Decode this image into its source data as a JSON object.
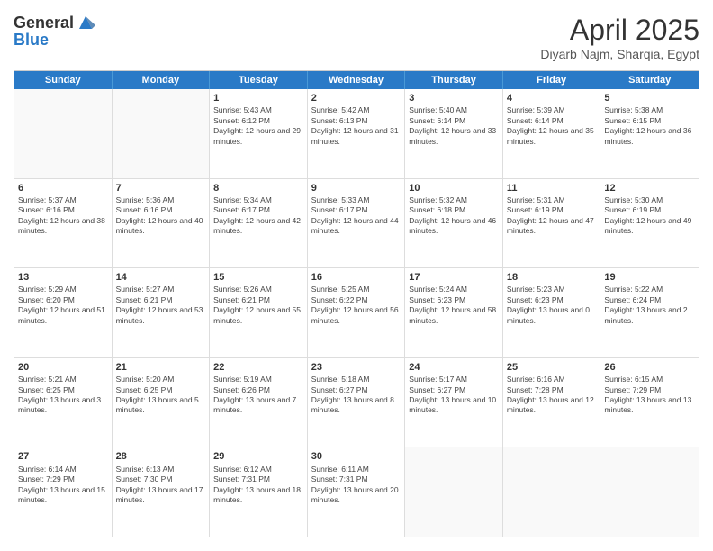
{
  "header": {
    "logo_line1": "General",
    "logo_line2": "Blue",
    "month": "April 2025",
    "location": "Diyarb Najm, Sharqia, Egypt"
  },
  "days": [
    "Sunday",
    "Monday",
    "Tuesday",
    "Wednesday",
    "Thursday",
    "Friday",
    "Saturday"
  ],
  "weeks": [
    [
      {
        "day": "",
        "info": ""
      },
      {
        "day": "",
        "info": ""
      },
      {
        "day": "1",
        "info": "Sunrise: 5:43 AM\nSunset: 6:12 PM\nDaylight: 12 hours and 29 minutes."
      },
      {
        "day": "2",
        "info": "Sunrise: 5:42 AM\nSunset: 6:13 PM\nDaylight: 12 hours and 31 minutes."
      },
      {
        "day": "3",
        "info": "Sunrise: 5:40 AM\nSunset: 6:14 PM\nDaylight: 12 hours and 33 minutes."
      },
      {
        "day": "4",
        "info": "Sunrise: 5:39 AM\nSunset: 6:14 PM\nDaylight: 12 hours and 35 minutes."
      },
      {
        "day": "5",
        "info": "Sunrise: 5:38 AM\nSunset: 6:15 PM\nDaylight: 12 hours and 36 minutes."
      }
    ],
    [
      {
        "day": "6",
        "info": "Sunrise: 5:37 AM\nSunset: 6:16 PM\nDaylight: 12 hours and 38 minutes."
      },
      {
        "day": "7",
        "info": "Sunrise: 5:36 AM\nSunset: 6:16 PM\nDaylight: 12 hours and 40 minutes."
      },
      {
        "day": "8",
        "info": "Sunrise: 5:34 AM\nSunset: 6:17 PM\nDaylight: 12 hours and 42 minutes."
      },
      {
        "day": "9",
        "info": "Sunrise: 5:33 AM\nSunset: 6:17 PM\nDaylight: 12 hours and 44 minutes."
      },
      {
        "day": "10",
        "info": "Sunrise: 5:32 AM\nSunset: 6:18 PM\nDaylight: 12 hours and 46 minutes."
      },
      {
        "day": "11",
        "info": "Sunrise: 5:31 AM\nSunset: 6:19 PM\nDaylight: 12 hours and 47 minutes."
      },
      {
        "day": "12",
        "info": "Sunrise: 5:30 AM\nSunset: 6:19 PM\nDaylight: 12 hours and 49 minutes."
      }
    ],
    [
      {
        "day": "13",
        "info": "Sunrise: 5:29 AM\nSunset: 6:20 PM\nDaylight: 12 hours and 51 minutes."
      },
      {
        "day": "14",
        "info": "Sunrise: 5:27 AM\nSunset: 6:21 PM\nDaylight: 12 hours and 53 minutes."
      },
      {
        "day": "15",
        "info": "Sunrise: 5:26 AM\nSunset: 6:21 PM\nDaylight: 12 hours and 55 minutes."
      },
      {
        "day": "16",
        "info": "Sunrise: 5:25 AM\nSunset: 6:22 PM\nDaylight: 12 hours and 56 minutes."
      },
      {
        "day": "17",
        "info": "Sunrise: 5:24 AM\nSunset: 6:23 PM\nDaylight: 12 hours and 58 minutes."
      },
      {
        "day": "18",
        "info": "Sunrise: 5:23 AM\nSunset: 6:23 PM\nDaylight: 13 hours and 0 minutes."
      },
      {
        "day": "19",
        "info": "Sunrise: 5:22 AM\nSunset: 6:24 PM\nDaylight: 13 hours and 2 minutes."
      }
    ],
    [
      {
        "day": "20",
        "info": "Sunrise: 5:21 AM\nSunset: 6:25 PM\nDaylight: 13 hours and 3 minutes."
      },
      {
        "day": "21",
        "info": "Sunrise: 5:20 AM\nSunset: 6:25 PM\nDaylight: 13 hours and 5 minutes."
      },
      {
        "day": "22",
        "info": "Sunrise: 5:19 AM\nSunset: 6:26 PM\nDaylight: 13 hours and 7 minutes."
      },
      {
        "day": "23",
        "info": "Sunrise: 5:18 AM\nSunset: 6:27 PM\nDaylight: 13 hours and 8 minutes."
      },
      {
        "day": "24",
        "info": "Sunrise: 5:17 AM\nSunset: 6:27 PM\nDaylight: 13 hours and 10 minutes."
      },
      {
        "day": "25",
        "info": "Sunrise: 6:16 AM\nSunset: 7:28 PM\nDaylight: 13 hours and 12 minutes."
      },
      {
        "day": "26",
        "info": "Sunrise: 6:15 AM\nSunset: 7:29 PM\nDaylight: 13 hours and 13 minutes."
      }
    ],
    [
      {
        "day": "27",
        "info": "Sunrise: 6:14 AM\nSunset: 7:29 PM\nDaylight: 13 hours and 15 minutes."
      },
      {
        "day": "28",
        "info": "Sunrise: 6:13 AM\nSunset: 7:30 PM\nDaylight: 13 hours and 17 minutes."
      },
      {
        "day": "29",
        "info": "Sunrise: 6:12 AM\nSunset: 7:31 PM\nDaylight: 13 hours and 18 minutes."
      },
      {
        "day": "30",
        "info": "Sunrise: 6:11 AM\nSunset: 7:31 PM\nDaylight: 13 hours and 20 minutes."
      },
      {
        "day": "",
        "info": ""
      },
      {
        "day": "",
        "info": ""
      },
      {
        "day": "",
        "info": ""
      }
    ]
  ]
}
